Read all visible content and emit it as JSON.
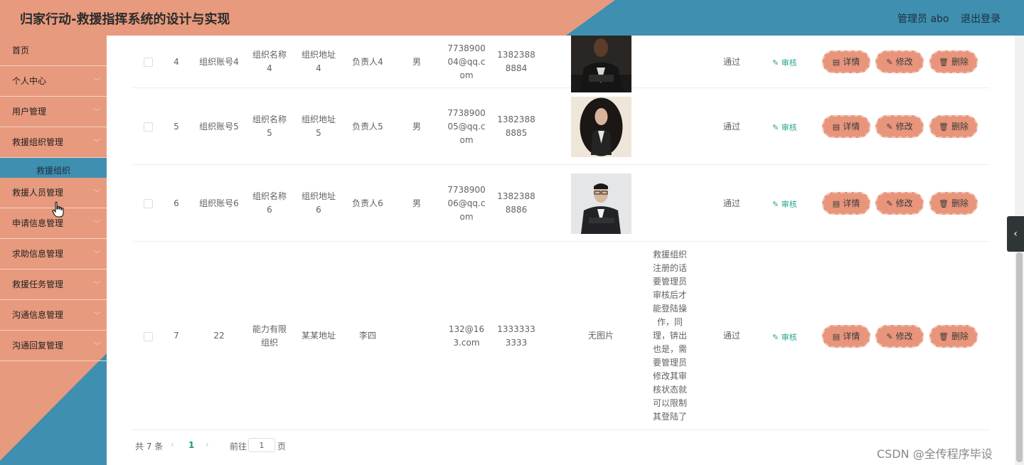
{
  "header": {
    "title": "归家行动-救援指挥系统的设计与实现",
    "user": "管理员 abo",
    "logout": "退出登录"
  },
  "sidebar": {
    "items": [
      {
        "label": "首页",
        "chevron": false
      },
      {
        "label": "个人中心",
        "chevron": true
      },
      {
        "label": "用户管理",
        "chevron": true
      },
      {
        "label": "救援组织管理",
        "chevron": true
      },
      {
        "label": "救援人员管理",
        "chevron": true
      },
      {
        "label": "申请信息管理",
        "chevron": true
      },
      {
        "label": "求助信息管理",
        "chevron": true
      },
      {
        "label": "救援任务管理",
        "chevron": true
      },
      {
        "label": "沟通信息管理",
        "chevron": true
      },
      {
        "label": "沟通回复管理",
        "chevron": true
      }
    ],
    "submenu": "救援组织"
  },
  "rows": [
    {
      "index": "4",
      "account": "组织账号4",
      "name": [
        "组织名称",
        "4"
      ],
      "address": [
        "组织地址",
        "4"
      ],
      "manager": "负责人4",
      "gender": "男",
      "email": [
        "7738900",
        "04@qq.c",
        "om"
      ],
      "phone": [
        "1382388",
        "8884"
      ],
      "photo": "man-dark-suit",
      "note": [],
      "status": "通过",
      "audit": "审核"
    },
    {
      "index": "5",
      "account": "组织账号5",
      "name": [
        "组织名称",
        "5"
      ],
      "address": [
        "组织地址",
        "5"
      ],
      "manager": "负责人5",
      "gender": "男",
      "email": [
        "7738900",
        "05@qq.c",
        "om"
      ],
      "phone": [
        "1382388",
        "8885"
      ],
      "photo": "woman-oval-portrait",
      "note": [],
      "status": "通过",
      "audit": "审核"
    },
    {
      "index": "6",
      "account": "组织账号6",
      "name": [
        "组织名称",
        "6"
      ],
      "address": [
        "组织地址",
        "6"
      ],
      "manager": "负责人6",
      "gender": "男",
      "email": [
        "7738900",
        "06@qq.c",
        "om"
      ],
      "phone": [
        "1382388",
        "8886"
      ],
      "photo": "man-glasses-suit",
      "note": [],
      "status": "通过",
      "audit": "审核"
    },
    {
      "index": "7",
      "account": "22",
      "name": [
        "能力有限",
        "组织"
      ],
      "address": [
        "某某地址"
      ],
      "manager": "李四",
      "gender": "",
      "email": [
        "132@16",
        "3.com"
      ],
      "phone": [
        "1333333",
        "3333"
      ],
      "photo": "",
      "no_image": "无图片",
      "note": [
        "救援组织",
        "注册的话",
        "要管理员",
        "审核后才",
        "能登陆操",
        "作，同",
        "理，锛出",
        "也是，需",
        "要管理员",
        "修改其审",
        "核状态就",
        "可以限制",
        "其登陆了"
      ],
      "status": "通过",
      "audit": "审核"
    }
  ],
  "buttons": {
    "detail": "详情",
    "edit": "修改",
    "delete": "删除"
  },
  "pagination": {
    "total": "共 7 条",
    "current": "1",
    "goto": "前往",
    "input_value": "1",
    "page_suffix": "页"
  },
  "watermark": "CSDN @全传程序毕设",
  "colors": {
    "accent_salmon": "#e89a7e",
    "accent_blue": "#3e8fb0",
    "audit_green": "#27a58b"
  }
}
